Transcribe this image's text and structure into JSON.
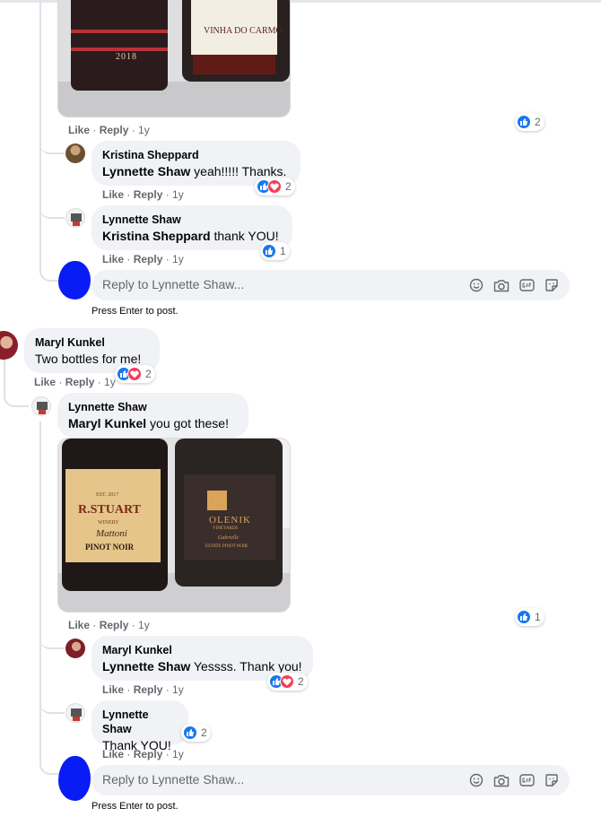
{
  "colors": {
    "accent": "#1877f2",
    "love": "#f33e58",
    "bubble": "#f0f2f5",
    "muted": "#65676b",
    "redacted": "#0a1cf5"
  },
  "top_post": {
    "photo_alt": "Two wine bottles labeled 2018 and VINHA DO CARMO",
    "bottle_left_year": "2018",
    "bottle_right_label": "VINHA DO CARMO",
    "meta": {
      "like": "Like",
      "reply": "Reply",
      "time": "1y"
    },
    "reaction_count": "2"
  },
  "reply_k1": {
    "author": "Kristina Sheppard",
    "mention": "Lynnette Shaw",
    "text": " yeah!!!!! Thanks.",
    "meta": {
      "like": "Like",
      "reply": "Reply",
      "time": "1y"
    },
    "reaction_count": "2"
  },
  "reply_l1": {
    "author": "Lynnette Shaw",
    "mention": "Kristina Sheppard",
    "text": " thank YOU!",
    "meta": {
      "like": "Like",
      "reply": "Reply",
      "time": "1y"
    },
    "reaction_count": "1"
  },
  "reply_input_1": {
    "placeholder": "Reply to Lynnette Shaw...",
    "hint": "Press Enter to post."
  },
  "comment_maryl": {
    "author": "Maryl Kunkel",
    "text": "Two bottles for me!",
    "meta": {
      "like": "Like",
      "reply": "Reply",
      "time": "1y"
    },
    "reaction_count": "2"
  },
  "comment_lynnette": {
    "author": "Lynnette Shaw",
    "mention": "Maryl Kunkel",
    "text": " you got these!",
    "photo_alt": "Two wine bottles: R.STUART & Co. Mattoni Pinot Noir and Olenik Vineyards Pinot Noir",
    "bottle_left_vintage": "EST. 2017",
    "bottle_left_brand": "R.STUART",
    "bottle_left_sub": "WINERY",
    "bottle_left_script": "Mattoni",
    "bottle_left_variety": "PINOT NOIR",
    "bottle_right_brand": "OLENIK",
    "bottle_right_sub": "VINEYARDS",
    "bottle_right_script": "Gabrielle",
    "bottle_right_line": "ESTATE PINOT NOIR",
    "meta": {
      "like": "Like",
      "reply": "Reply",
      "time": "1y"
    },
    "reaction_count": "1"
  },
  "reply_m2": {
    "author": "Maryl Kunkel",
    "mention": "Lynnette Shaw",
    "text": " Yessss. Thank you!",
    "meta": {
      "like": "Like",
      "reply": "Reply",
      "time": "1y"
    },
    "reaction_count": "2"
  },
  "reply_l2": {
    "author": "Lynnette Shaw",
    "text": "Thank YOU!",
    "meta": {
      "like": "Like",
      "reply": "Reply",
      "time": "1y"
    },
    "reaction_count": "2"
  },
  "reply_input_2": {
    "placeholder": "Reply to Lynnette Shaw...",
    "hint": "Press Enter to post."
  },
  "icons": [
    "like-icon",
    "love-icon",
    "emoji-icon",
    "camera-icon",
    "gif-icon",
    "sticker-icon"
  ]
}
